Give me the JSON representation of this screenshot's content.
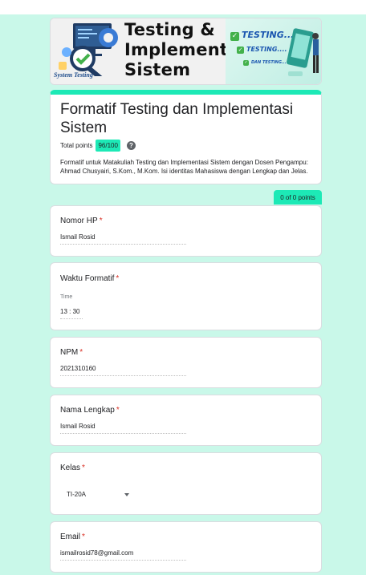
{
  "banner": {
    "title_lines": [
      "Testing &",
      "Implementasi",
      "Sistem"
    ],
    "subtitle": "System Testing",
    "badges": [
      "TESTING...",
      "TESTING....",
      "DAN TESTING..."
    ]
  },
  "form": {
    "title": "Formatif Testing dan Implementasi Sistem",
    "total_points_label": "Total points",
    "total_points_value": "96/100",
    "description": "Formatif untuk Matakuliah Testing dan Implementasi Sistem dengan Dosen Pengampu: Ahmad Chusyairi, S.Kom., M.Kom. Isi identitas Mahasiswa dengan Lengkap dan Jelas."
  },
  "section": {
    "points": "0 of 0 points"
  },
  "questions": {
    "nomor_hp": {
      "label": "Nomor HP",
      "required": "*",
      "value": "Ismail Rosid"
    },
    "waktu": {
      "label": "Waktu Formatif",
      "required": "*",
      "sub_label": "Time",
      "hour": "13",
      "sep": ":",
      "minute": "30"
    },
    "npm": {
      "label": "NPM",
      "required": "*",
      "value": "2021310160"
    },
    "nama": {
      "label": "Nama Lengkap",
      "required": "*",
      "value": "Ismail Rosid"
    },
    "kelas": {
      "label": "Kelas",
      "required": "*",
      "value": "TI-20A"
    },
    "email": {
      "label": "Email",
      "required": "*",
      "value": "ismailrosid78@gmail.com"
    }
  },
  "colors": {
    "accent": "#1de9b6",
    "background": "#c9f8e9",
    "required": "#d93025"
  }
}
